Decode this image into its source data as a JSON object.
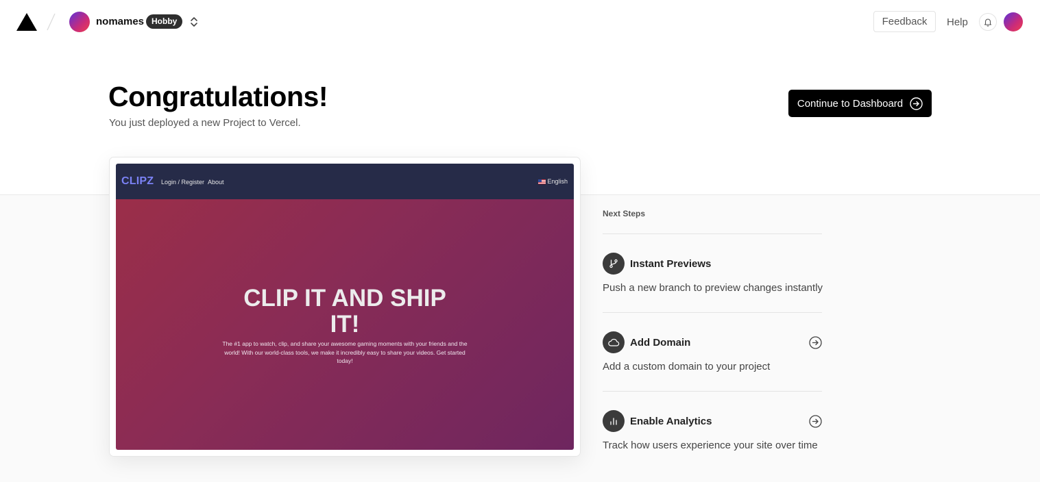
{
  "header": {
    "team_name": "nomames",
    "plan_badge": "Hobby",
    "feedback_label": "Feedback",
    "help_label": "Help"
  },
  "hero": {
    "title": "Congratulations!",
    "subtitle": "You just deployed a new Project to Vercel.",
    "continue_label": "Continue to Dashboard"
  },
  "preview": {
    "site_logo": "CLIPZ",
    "nav_links": [
      "Login / Register",
      "About"
    ],
    "language": "English",
    "headline_line1": "CLIP IT AND SHIP",
    "headline_line2": "IT!",
    "description": "The #1 app to watch, clip, and share your awesome gaming moments with your friends and the world! With our world-class tools, we make it incredibly easy to share your videos. Get started today!"
  },
  "next_steps": {
    "title": "Next Steps",
    "items": [
      {
        "icon": "git-branch-icon",
        "title": "Instant Previews",
        "description": "Push a new branch to preview changes instantly",
        "has_arrow": false
      },
      {
        "icon": "cloud-icon",
        "title": "Add Domain",
        "description": "Add a custom domain to your project",
        "has_arrow": true
      },
      {
        "icon": "bar-chart-icon",
        "title": "Enable Analytics",
        "description": "Track how users experience your site over time",
        "has_arrow": true
      }
    ]
  },
  "colors": {
    "accent": "#000000",
    "preview_nav": "#262b48",
    "preview_logo": "#7b82f5",
    "preview_gradient_start": "#9b2e49",
    "preview_gradient_end": "#6e265f",
    "plan_badge_bg": "#2e2e2e"
  }
}
